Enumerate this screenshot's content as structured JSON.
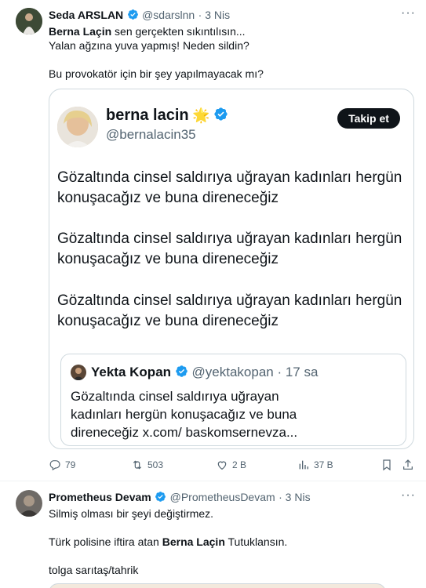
{
  "post1": {
    "author_name": "Seda ARSLAN",
    "handle": "@sdarslnn",
    "time": "· 3 Nis",
    "line1": "sen gerçekten sıkıntılısın...",
    "line1_name": "Berna Laçin",
    "line2": "Yalan ağzına yuva yapmış! Neden sildin?",
    "line3": "Bu provokatör için bir şey yapılmayacak mı?",
    "quoted": {
      "author_name": "berna lacin",
      "emoji": "🌟",
      "handle": "@bernalacin35",
      "follow_label": "Takip et",
      "paragraphs": [
        "Gözaltında cinsel saldırıya uğrayan kadınları hergün konuşacağız ve buna direneceğiz",
        "Gözaltında cinsel saldırıya uğrayan kadınları hergün konuşacağız ve buna direneceğiz",
        "Gözaltında cinsel saldırıya uğrayan kadınları hergün konuşacağız ve buna direneceğiz"
      ],
      "nested": {
        "author_name": "Yekta Kopan",
        "handle": "@yektakopan",
        "time": "· 17 sa",
        "text": "Gözaltında cinsel saldırıya uğrayan kadınları hergün konuşacağız ve buna direneceğiz x.com/ baskomsernevza..."
      }
    },
    "actions": {
      "replies": "79",
      "reposts": "503",
      "likes": "2 B",
      "views": "37 B"
    }
  },
  "post2": {
    "author_name": "Prometheus Devam",
    "handle": "@PrometheusDevam",
    "time": "· 3 Nis",
    "line1": "Silmiş olması bir şeyi değiştirmez.",
    "line2_pre": "Türk polisine iftira atan",
    "line2_name": "Berna Laçin",
    "line2_post": "Tutuklansın.",
    "line3": "tolga sarıtaş/tahrik"
  },
  "colors": {
    "verified": "#1d9bf0",
    "muted": "#536471",
    "border": "#cfd9de"
  }
}
